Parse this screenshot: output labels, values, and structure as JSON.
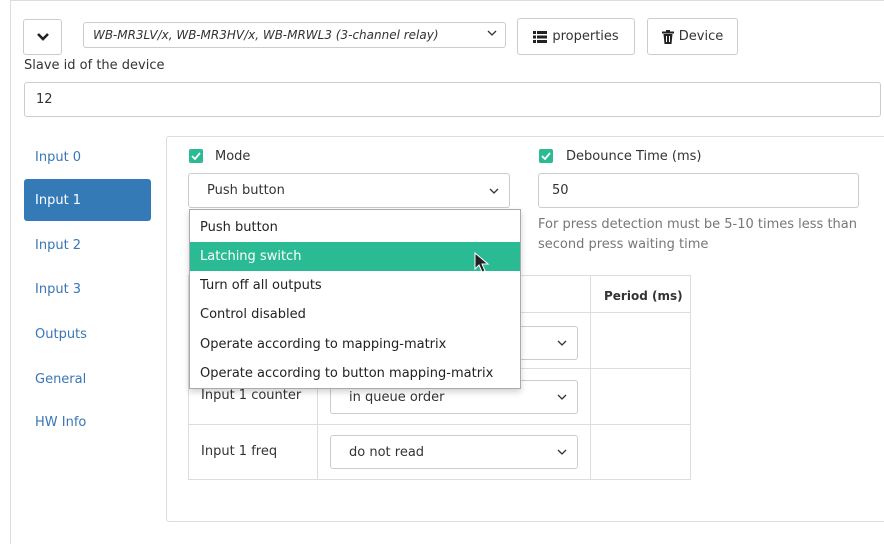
{
  "toolbar": {
    "device_template": "WB-MR3LV/x, WB-MR3HV/x, WB-MRWL3 (3-channel relay)",
    "properties_label": "properties",
    "device_label": "Device"
  },
  "slave": {
    "label": "Slave id of the device",
    "value": "12"
  },
  "sidebar": {
    "items": [
      {
        "label": "Input 0"
      },
      {
        "label": "Input 1",
        "active": true
      },
      {
        "label": "Input 2"
      },
      {
        "label": "Input 3"
      },
      {
        "label": "Outputs"
      },
      {
        "label": "General"
      },
      {
        "label": "HW Info"
      }
    ]
  },
  "mode": {
    "label": "Mode",
    "checked": true,
    "value": "Push button",
    "options": [
      "Push button",
      "Latching switch",
      "Turn off all outputs",
      "Control disabled",
      "Operate according to mapping-matrix",
      "Operate according to button mapping-matrix"
    ],
    "highlighted": "Latching switch"
  },
  "debounce": {
    "label": "Debounce Time (ms)",
    "checked": true,
    "value": "50",
    "help": "For press detection must be 5-10 times less than second press waiting time"
  },
  "table": {
    "period_header": "Period (ms)",
    "rows": [
      {
        "label": "Input 1 counter",
        "value": "in queue order"
      },
      {
        "label": "Input 1 freq",
        "value": "do not read"
      }
    ]
  },
  "colors": {
    "accent": "#2bbb94",
    "primary": "#337ab7",
    "link": "#3a76b6"
  },
  "icons": [
    "chevron-down-icon",
    "list-icon",
    "trash-icon",
    "check-icon",
    "mouse-pointer-icon"
  ]
}
